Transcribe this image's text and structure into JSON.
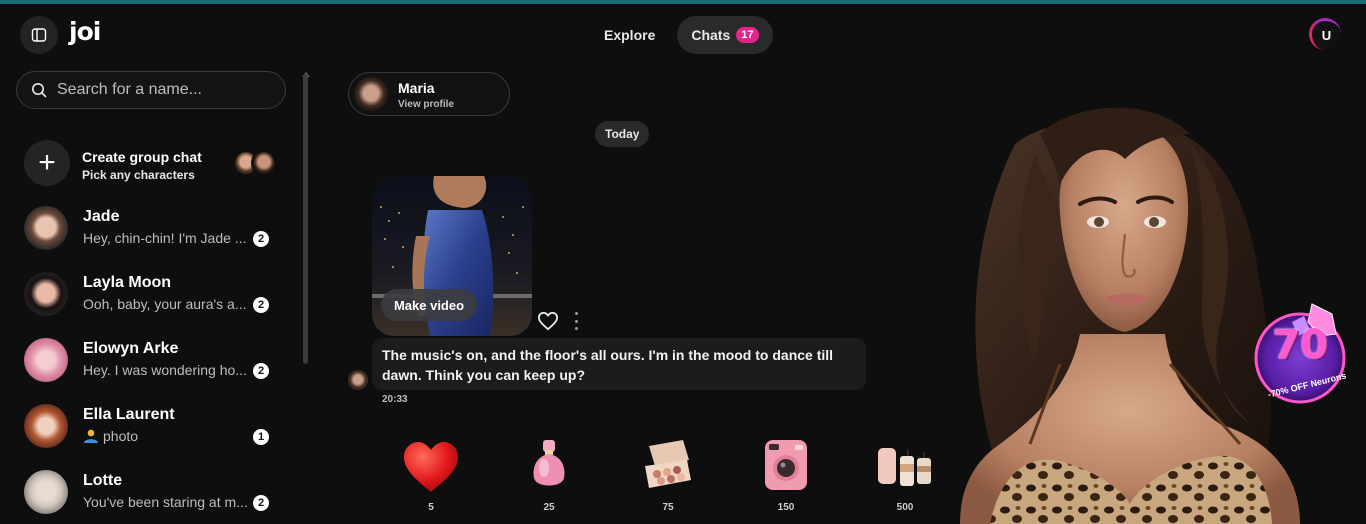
{
  "app": {
    "logo": "joi",
    "nav": [
      {
        "label": "Explore",
        "active": false
      },
      {
        "label": "Chats",
        "active": true,
        "badge": "17"
      }
    ],
    "user_initial": "U"
  },
  "sidebar": {
    "search_placeholder": "Search for a name...",
    "group_chat": {
      "title": "Create group chat",
      "subtitle": "Pick any characters"
    },
    "chats": [
      {
        "name": "Jade",
        "preview": "Hey, chin-chin! I'm Jade ...",
        "unread": "2"
      },
      {
        "name": "Layla Moon",
        "preview": "Ooh, baby, your aura's a...",
        "unread": "2"
      },
      {
        "name": "Elowyn Arke",
        "preview": "Hey. I was wondering ho...",
        "unread": "2"
      },
      {
        "name": "Ella Laurent",
        "preview_icon": "photo-person-icon",
        "preview": "photo",
        "unread": "1"
      },
      {
        "name": "Lotte",
        "preview": "You've been staring at m...",
        "unread": "2"
      }
    ]
  },
  "conversation": {
    "profile": {
      "name": "Maria",
      "link": "View profile"
    },
    "date_label": "Today",
    "message": {
      "image_button": "Make video",
      "text": "The music's on, and the floor's all ours. I'm in the mood to dance till dawn. Think you can keep up?",
      "time": "20:33"
    },
    "gifts": [
      {
        "icon": "heart-gift-icon",
        "price": "5"
      },
      {
        "icon": "perfume-gift-icon",
        "price": "25"
      },
      {
        "icon": "makeup-palette-gift-icon",
        "price": "75"
      },
      {
        "icon": "instant-camera-gift-icon",
        "price": "150"
      },
      {
        "icon": "candles-gift-icon",
        "price": "500"
      }
    ]
  },
  "promo": {
    "number": "70",
    "text": "-70% OFF Neurons"
  },
  "colors": {
    "accent_pink": "#e4258a",
    "teal_line": "#1b6f78",
    "background": "#0e0e0f"
  }
}
